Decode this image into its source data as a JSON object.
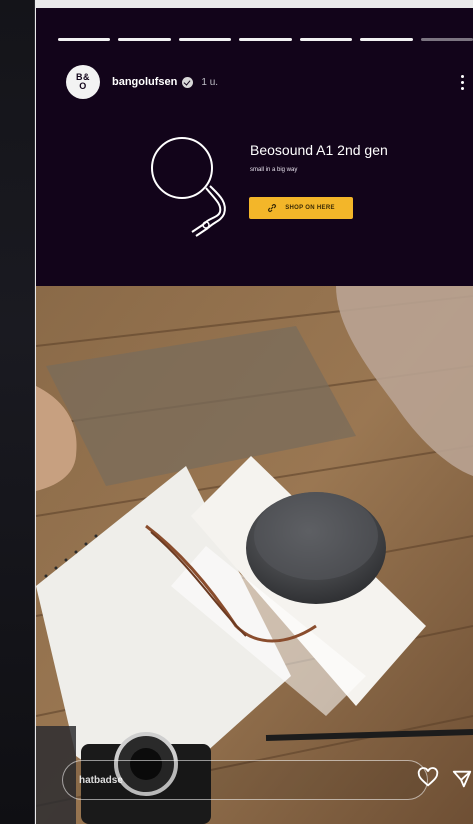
{
  "story": {
    "progress": {
      "segments_total": 7,
      "segments_completed": 6
    },
    "account": {
      "avatar_initials_line1": "B&",
      "avatar_initials_line2": "O",
      "username": "bangolufsen",
      "verified_icon": "verified-badge-icon",
      "time_ago": "1 u."
    },
    "menu_icon": "more-vertical-icon",
    "product": {
      "title": "Beosound A1 2nd gen",
      "subtitle": "small in a big way",
      "cta_label": "SHOP ON HERE",
      "cta_icon": "link-icon"
    },
    "footer": {
      "reply_label": "hatbadse",
      "like_icon": "heart-icon",
      "send_icon": "send-icon"
    },
    "colors": {
      "story_background": "#12041a",
      "cta_background": "#f3b629"
    }
  }
}
